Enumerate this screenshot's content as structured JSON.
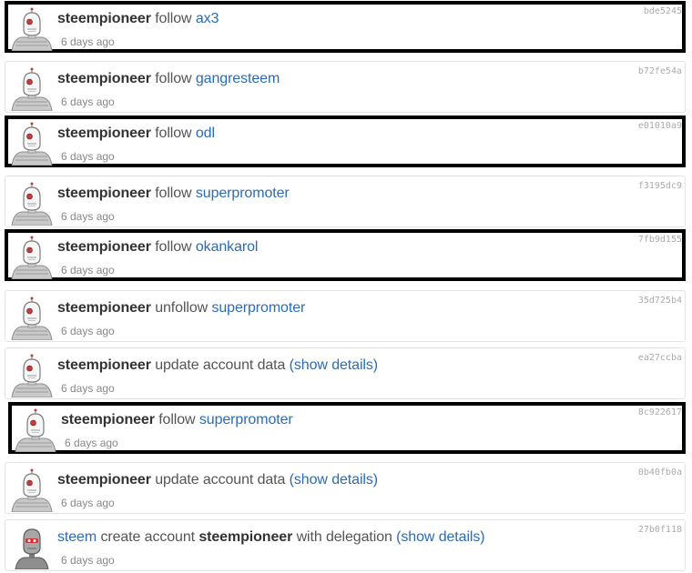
{
  "items": [
    {
      "id": "bde5245",
      "verb": "follow",
      "target": "ax3",
      "account": "steempioneer",
      "time": "6 days ago"
    },
    {
      "id": "b72fe54a",
      "verb": "follow",
      "target": "gangresteem",
      "account": "steempioneer",
      "time": "6 days ago"
    },
    {
      "id": "e01010a9",
      "verb": "follow",
      "target": "odl",
      "account": "steempioneer",
      "time": "6 days ago"
    },
    {
      "id": "f3195dc9",
      "verb": "follow",
      "target": "superpromoter",
      "account": "steempioneer",
      "time": "6 days ago"
    },
    {
      "id": "7fb9d155",
      "verb": "follow",
      "target": "okankarol",
      "account": "steempioneer",
      "time": "6 days ago"
    },
    {
      "id": "35d725b4",
      "verb": "unfollow",
      "target": "superpromoter",
      "account": "steempioneer",
      "time": "6 days ago"
    },
    {
      "id": "ea27ccba",
      "verb": "update account data",
      "target": "(show details)",
      "account": "steempioneer",
      "time": "6 days ago"
    },
    {
      "id": "8c922617",
      "verb": "follow",
      "target": "superpromoter",
      "account": "steempioneer",
      "time": "6 days ago"
    },
    {
      "id": "0b40fb0a",
      "verb": "update account data",
      "target": "(show details)",
      "account": "steempioneer",
      "time": "6 days ago"
    },
    {
      "id": "27b0f118",
      "creator": "steem",
      "verb": "create account",
      "account": "steempioneer",
      "suffix": "with delegation",
      "target": "(show details)",
      "time": "6 days ago"
    }
  ],
  "colors": {
    "link": "#2a6cb5",
    "account": "#333333",
    "text": "#555555",
    "muted": "#888888",
    "trx": "#aaaaaa",
    "highlight": "#000000"
  }
}
